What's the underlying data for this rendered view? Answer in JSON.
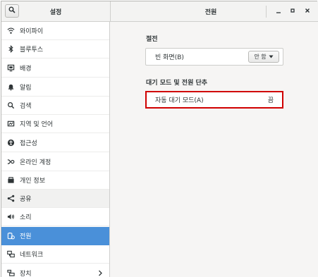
{
  "window": {
    "controls": {
      "minimize": "—",
      "maximize": "▫",
      "close": "✕"
    }
  },
  "header": {
    "left_title": "설정",
    "right_title": "전원",
    "search_icon": "search-icon"
  },
  "sidebar": {
    "items": [
      {
        "label": "와이파이",
        "icon": "wifi-icon"
      },
      {
        "label": "블루투스",
        "icon": "bluetooth-icon"
      },
      {
        "label": "배경",
        "icon": "background-icon"
      },
      {
        "label": "알림",
        "icon": "bell-icon"
      },
      {
        "label": "검색",
        "icon": "search-icon"
      },
      {
        "label": "지역 및 언어",
        "icon": "region-icon"
      },
      {
        "label": "접근성",
        "icon": "accessibility-icon"
      },
      {
        "label": "온라인 계정",
        "icon": "online-accounts-icon"
      },
      {
        "label": "개인 정보",
        "icon": "privacy-icon"
      },
      {
        "label": "공유",
        "icon": "share-icon"
      },
      {
        "label": "소리",
        "icon": "speaker-icon"
      },
      {
        "label": "전원",
        "icon": "power-icon"
      },
      {
        "label": "네트워크",
        "icon": "network-icon"
      },
      {
        "label": "장치",
        "icon": "devices-icon"
      }
    ],
    "active_label": "전원"
  },
  "main": {
    "power_saving": {
      "title": "절전",
      "blank_screen_label": "빈 화면(B)",
      "blank_screen_value": "안 함"
    },
    "suspend": {
      "title": "대기 모드 및 전원 단추",
      "auto_suspend_label": "자동 대기 모드(A)",
      "auto_suspend_value": "끔"
    }
  },
  "colors": {
    "accent": "#4a90d9",
    "highlight": "#d00000"
  }
}
